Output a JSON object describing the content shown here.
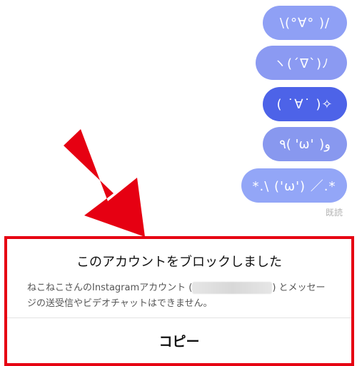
{
  "messages": [
    {
      "text": "\\(°∀° )/"
    },
    {
      "text": "ヽ(´∇`)ﾉ"
    },
    {
      "text": "( ˙∀˙ )✧"
    },
    {
      "text": "٩( 'ω' )و"
    },
    {
      "text": "*.\\ ('ω') ／.*"
    }
  ],
  "read_status": "既読",
  "block_notice": {
    "title": "このアカウントをブロックしました",
    "desc_before": "ねこねこさんのInstagramアカウント (",
    "desc_after": ") とメッセージの送受信やビデオチャットはできません。",
    "copy_label": "コピー"
  },
  "colors": {
    "bubble_light": "#8b9af2",
    "bubble_dark": "#4d63e8",
    "highlight_red": "#e60012"
  }
}
